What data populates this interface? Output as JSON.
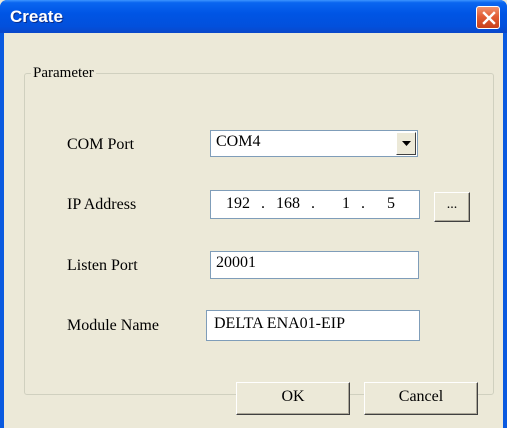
{
  "window": {
    "title": "Create"
  },
  "group": {
    "legend": "Parameter"
  },
  "com_port": {
    "label": "COM Port",
    "value": "COM4"
  },
  "ip_address": {
    "label": "IP Address",
    "octets": [
      "192",
      "168",
      "1",
      "5"
    ],
    "separator": ".",
    "browse_label": "..."
  },
  "listen_port": {
    "label": "Listen Port",
    "value": "20001"
  },
  "module_name": {
    "label": "Module Name",
    "value": "DELTA ENA01-EIP"
  },
  "buttons": {
    "ok": "OK",
    "cancel": "Cancel"
  }
}
